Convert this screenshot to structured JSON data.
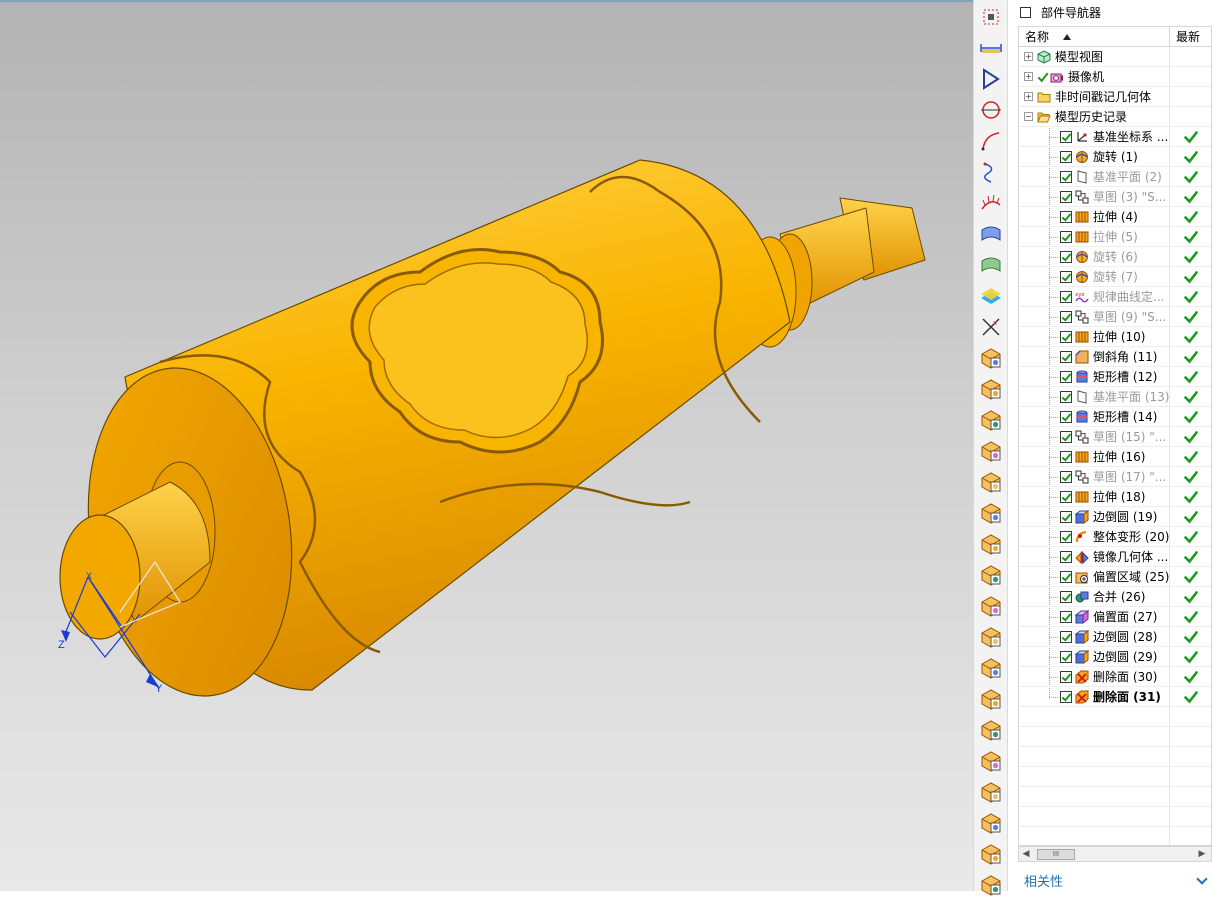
{
  "navigator": {
    "title": "部件导航器",
    "columns": {
      "name": "名称",
      "latest": "最新"
    },
    "groups": [
      {
        "label": "模型视图",
        "icon": "model-views-icon",
        "expander": "+"
      },
      {
        "label": "摄像机",
        "icon": "camera-icon",
        "expander": "+"
      },
      {
        "label": "非时间戳记几何体",
        "icon": "folder-icon",
        "expander": "+"
      },
      {
        "label": "模型历史记录",
        "icon": "folder-open-icon",
        "expander": "-"
      }
    ],
    "features": [
      {
        "label": "基准坐标系 ...",
        "icon": "datum-csys-icon",
        "dim": false,
        "bold": false
      },
      {
        "label": "旋转 (1)",
        "icon": "revolve-icon",
        "dim": false,
        "bold": false
      },
      {
        "label": "基准平面 (2)",
        "icon": "datum-plane-icon",
        "dim": true,
        "bold": false
      },
      {
        "label": "草图 (3) \"S...",
        "icon": "sketch-icon",
        "dim": true,
        "bold": false
      },
      {
        "label": "拉伸 (4)",
        "icon": "extrude-icon",
        "dim": false,
        "bold": false
      },
      {
        "label": "拉伸 (5)",
        "icon": "extrude-icon",
        "dim": true,
        "bold": false
      },
      {
        "label": "旋转 (6)",
        "icon": "revolve-icon",
        "dim": true,
        "bold": false
      },
      {
        "label": "旋转 (7)",
        "icon": "revolve-icon",
        "dim": true,
        "bold": false
      },
      {
        "label": "规律曲线定...",
        "icon": "law-curve-icon",
        "dim": true,
        "bold": false
      },
      {
        "label": "草图 (9) \"S...",
        "icon": "sketch-icon",
        "dim": true,
        "bold": false
      },
      {
        "label": "拉伸 (10)",
        "icon": "extrude-icon",
        "dim": false,
        "bold": false
      },
      {
        "label": "倒斜角 (11)",
        "icon": "chamfer-icon",
        "dim": false,
        "bold": false
      },
      {
        "label": "矩形槽 (12)",
        "icon": "rect-groove-icon",
        "dim": false,
        "bold": false
      },
      {
        "label": "基准平面 (13)",
        "icon": "datum-plane-icon",
        "dim": true,
        "bold": false
      },
      {
        "label": "矩形槽 (14)",
        "icon": "rect-groove-icon",
        "dim": false,
        "bold": false
      },
      {
        "label": "草图 (15) \"...",
        "icon": "sketch-icon",
        "dim": true,
        "bold": false
      },
      {
        "label": "拉伸 (16)",
        "icon": "extrude-icon",
        "dim": false,
        "bold": false
      },
      {
        "label": "草图 (17) \"...",
        "icon": "sketch-icon",
        "dim": true,
        "bold": false
      },
      {
        "label": "拉伸 (18)",
        "icon": "extrude-icon",
        "dim": false,
        "bold": false
      },
      {
        "label": "边倒圆 (19)",
        "icon": "edge-blend-icon",
        "dim": false,
        "bold": false
      },
      {
        "label": "整体变形 (20)",
        "icon": "global-shaping-icon",
        "dim": false,
        "bold": false
      },
      {
        "label": "镜像几何体 ...",
        "icon": "mirror-geometry-icon",
        "dim": false,
        "bold": false
      },
      {
        "label": "偏置区域 (25)",
        "icon": "offset-region-icon",
        "dim": false,
        "bold": false
      },
      {
        "label": "合并 (26)",
        "icon": "unite-icon",
        "dim": false,
        "bold": false
      },
      {
        "label": "偏置面 (27)",
        "icon": "offset-face-icon",
        "dim": false,
        "bold": false
      },
      {
        "label": "边倒圆 (28)",
        "icon": "edge-blend-icon",
        "dim": false,
        "bold": false
      },
      {
        "label": "边倒圆 (29)",
        "icon": "edge-blend-icon",
        "dim": false,
        "bold": false
      },
      {
        "label": "删除面 (30)",
        "icon": "delete-face-icon",
        "dim": false,
        "bold": false
      },
      {
        "label": "删除面 (31)",
        "icon": "delete-face-icon",
        "dim": false,
        "bold": true
      }
    ],
    "scroll_thumb": "III",
    "footer": "相关性"
  },
  "viewport": {
    "triad_labels": {
      "x": "X",
      "y": "Y",
      "z": "Z"
    }
  },
  "toolbar": {
    "buttons": [
      "box-select-icon",
      "measure-distance-icon",
      "datum-plane-tool-icon",
      "circle-icon",
      "arc-icon",
      "spline-icon",
      "comb-icon",
      "surface-icon",
      "mesh-surface-icon",
      "layer-icon",
      "trim-icon",
      "solid-op-1-icon",
      "solid-op-2-icon",
      "solid-op-3-icon",
      "solid-op-4-icon",
      "solid-op-5-icon",
      "solid-op-6-icon",
      "solid-op-7-icon",
      "solid-op-8-icon",
      "solid-op-9-icon",
      "solid-op-10-icon",
      "solid-op-11-icon",
      "solid-op-12-icon",
      "solid-op-13-icon",
      "solid-op-14-icon",
      "solid-op-15-icon",
      "solid-op-16-icon",
      "solid-op-17-icon",
      "solid-op-18-icon"
    ]
  },
  "colors": {
    "part_gold": "#f5b000",
    "check_green": "#1c9a1c",
    "link_blue": "#1f6fb5"
  }
}
